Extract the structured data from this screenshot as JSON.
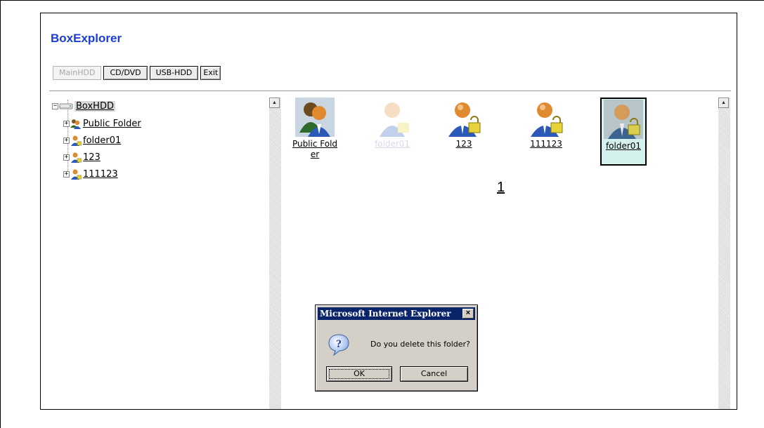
{
  "app": {
    "title": "BoxExplorer"
  },
  "toolbar": {
    "main_hdd": "MainHDD",
    "cd_dvd": "CD/DVD",
    "usb_hdd": "USB-HDD",
    "exit": "Exit"
  },
  "tree": {
    "root": {
      "label": "BoxHDD",
      "expander": "−"
    },
    "items": [
      {
        "label": "Public Folder",
        "expander": "+",
        "icon": "group-user-icon"
      },
      {
        "label": "folder01",
        "expander": "+",
        "icon": "locked-user-icon"
      },
      {
        "label": "123",
        "expander": "+",
        "icon": "locked-user-icon"
      },
      {
        "label": "111123",
        "expander": "+",
        "icon": "locked-user-icon"
      }
    ]
  },
  "folders": [
    {
      "label": "Public Folder",
      "icon": "group-user-icon",
      "state": "normal"
    },
    {
      "label": "folder01",
      "icon": "locked-user-icon",
      "state": "dragging-ghost"
    },
    {
      "label": "123",
      "icon": "locked-user-icon",
      "state": "normal"
    },
    {
      "label": "111123",
      "icon": "locked-user-icon",
      "state": "normal"
    },
    {
      "label": "folder01",
      "icon": "locked-user-icon",
      "state": "selected"
    }
  ],
  "pagination": {
    "current_page": "1"
  },
  "dialog": {
    "title": "Microsoft Internet Explorer",
    "close": "×",
    "message": "Do you delete this folder?",
    "ok_label": "OK",
    "cancel_label": "Cancel",
    "icon": "question-icon"
  },
  "colors": {
    "brand_title": "#1a3dd9",
    "dialog_titlebar": "#0a246a",
    "dialog_face": "#d4d0c8",
    "selected_tile": "#d5f1ee"
  }
}
